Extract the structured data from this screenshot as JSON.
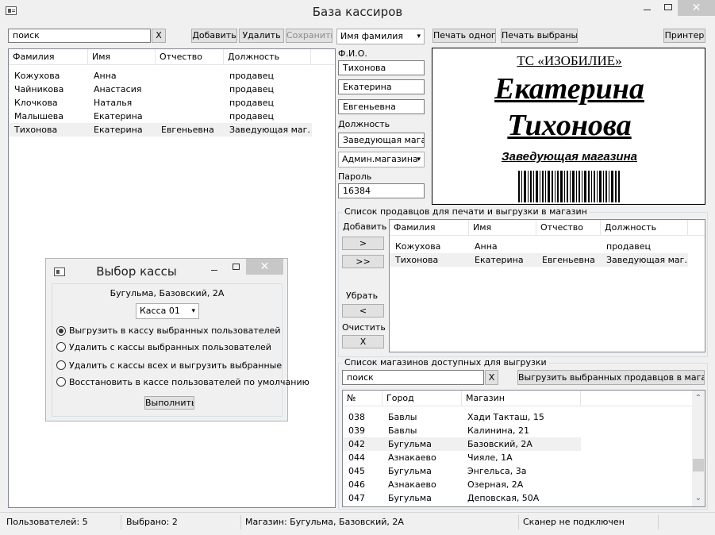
{
  "window": {
    "title": "База кассиров",
    "min_symbol": "—",
    "close_symbol": "✕"
  },
  "toolbar": {
    "search_value": "поиск",
    "clear_label": "X",
    "add_label": "Добавить",
    "delete_label": "Удалить",
    "save_label": "Сохранить",
    "sort_selected": "Имя фамилия",
    "print_one_label": "Печать одного",
    "print_selected_label": "Печать выбраных",
    "printer_label": "Принтер"
  },
  "users_table": {
    "columns": [
      "Фамилия",
      "Имя",
      "Отчество",
      "Должность"
    ],
    "rows": [
      [
        "Кожухова",
        "Анна",
        "",
        "продавец"
      ],
      [
        "Чайникова",
        "Анастасия",
        "",
        "продавец"
      ],
      [
        "Клочкова",
        "Наталья",
        "",
        "продавец"
      ],
      [
        "Малышева",
        "Екатерина",
        "",
        "продавец"
      ],
      [
        "Тихонова",
        "Екатерина",
        "Евгеньевна",
        "Заведующая маг..."
      ]
    ]
  },
  "form": {
    "fio_label": "Ф.И.О.",
    "last_name": "Тихонова",
    "first_name": "Екатерина",
    "patronymic": "Евгеньевна",
    "position_label": "Должность",
    "position_value": "Заведующая магаз",
    "role_selected": "Админ.магазина",
    "password_label": "Пароль",
    "password_value": "16384"
  },
  "card": {
    "company": "ТС «ИЗОБИЛИЕ»",
    "first_name": "Екатерина",
    "last_name": "Тихонова",
    "position": "Заведующая магазина"
  },
  "sellers": {
    "group_title": "Список продавцов для печати и выгрузки в магазин",
    "add_label": "Добавить",
    "add_one_label": ">",
    "add_all_label": ">>",
    "remove_label": "Убрать",
    "remove_one_label": "<",
    "clear_label": "Очистить",
    "clear_btn_label": "X",
    "columns": [
      "Фамилия",
      "Имя",
      "Отчество",
      "Должность"
    ],
    "rows": [
      [
        "Кожухова",
        "Анна",
        "",
        "продавец"
      ],
      [
        "Тихонова",
        "Екатерина",
        "Евгеньевна",
        "Заведующая маг..."
      ]
    ]
  },
  "stores": {
    "group_title": "Список магазинов доступных для выгрузки",
    "search_value": "поиск",
    "clear_label": "X",
    "upload_label": "Выгрузить выбранных продавцов в магазин",
    "columns": [
      "№",
      "Город",
      "Магазин"
    ],
    "rows": [
      [
        "038",
        "Бавлы",
        "Хади Такташ, 15"
      ],
      [
        "039",
        "Бавлы",
        "Калинина, 21"
      ],
      [
        "042",
        "Бугульма",
        "Базовский, 2А"
      ],
      [
        "044",
        "Азнакаево",
        "Чияле, 1А"
      ],
      [
        "045",
        "Бугульма",
        "Энгельса, 3а"
      ],
      [
        "046",
        "Азнакаево",
        "Озерная, 2А"
      ],
      [
        "047",
        "Бугульма",
        "Деповская, 50А"
      ]
    ]
  },
  "dialog": {
    "title": "Выбор кассы",
    "store": "Бугульма, Базовский, 2А",
    "register_selected": "Касса 01",
    "options": [
      "Выгрузить в кассу выбранных пользователей",
      "Удалить с кассы выбранных пользователей",
      "Удалить с кассы всех и выгрузить выбранные",
      "Восстановить в кассе пользователей по умолчанию"
    ],
    "selected_option_index": 0,
    "execute_label": "Выполнить"
  },
  "status": {
    "users": "Пользователей: 5",
    "selected": "Выбрано: 2",
    "store": "Магазин: Бугульма, Базовский, 2А",
    "scanner": "Сканер не подключен"
  }
}
